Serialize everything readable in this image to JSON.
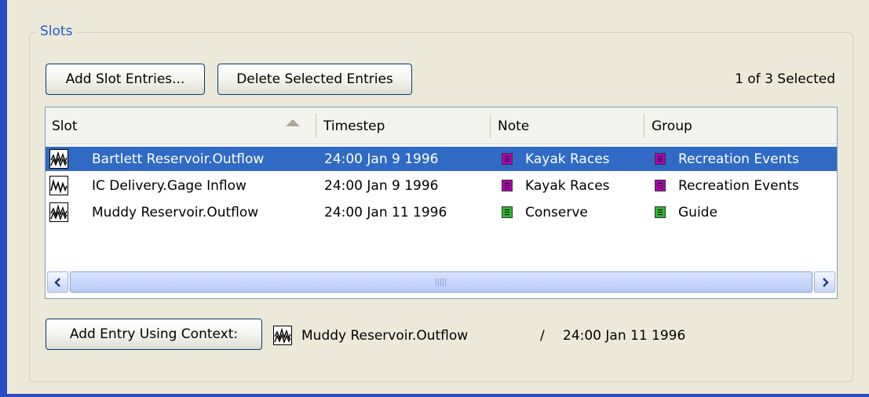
{
  "group": {
    "title": "Slots"
  },
  "toolbar": {
    "add_slot_entries_label": "Add Slot Entries...",
    "delete_selected_label": "Delete Selected Entries",
    "selection_count": "1 of 3 Selected"
  },
  "table": {
    "columns": [
      "Slot",
      "Timestep",
      "Note",
      "Group"
    ],
    "sort_column": "Slot",
    "rows": [
      {
        "icon": "timeseries-slot-icon",
        "slot": "Bartlett Reservoir.Outflow",
        "timestep": "24:00 Jan 9 1996",
        "note": "Kayak Races",
        "note_color": "#b000b0",
        "group": "Recreation Events",
        "group_color": "#b000b0",
        "selected": true
      },
      {
        "icon": "gage-slot-icon",
        "slot": "IC Delivery.Gage Inflow",
        "timestep": "24:00 Jan 9 1996",
        "note": "Kayak Races",
        "note_color": "#b000b0",
        "group": "Recreation Events",
        "group_color": "#b000b0",
        "selected": false
      },
      {
        "icon": "timeseries-slot-icon",
        "slot": "Muddy Reservoir.Outflow",
        "timestep": "24:00 Jan 11 1996",
        "note": "Conserve",
        "note_color": "#2eb82e",
        "group": "Guide",
        "group_color": "#2eb82e",
        "selected": false
      }
    ]
  },
  "context": {
    "button_label": "Add Entry Using Context:",
    "slot": "Muddy Reservoir.Outflow",
    "separator": "/",
    "timestep": "24:00 Jan 11 1996"
  },
  "colors": {
    "accent": "#316ac5",
    "frame": "#2a4cc0",
    "title": "#1f5ad6"
  }
}
